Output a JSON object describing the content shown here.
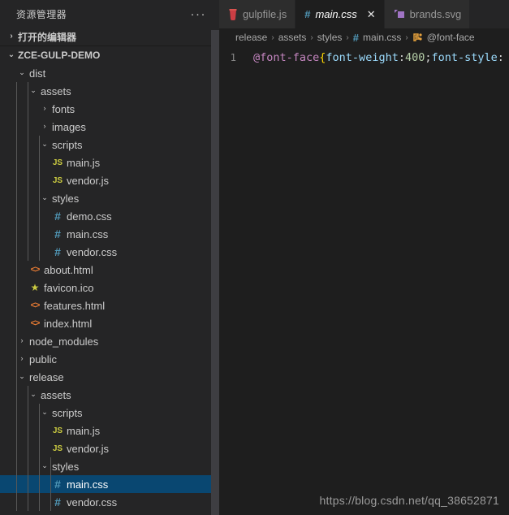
{
  "sidebar": {
    "title": "资源管理器",
    "more_actions_label": "···",
    "open_editors": {
      "label": "打开的编辑器",
      "chevron": "›",
      "expanded": false
    },
    "project": {
      "label": "ZCE-GULP-DEMO",
      "chevron": "⌄",
      "expanded": true
    },
    "tree": [
      {
        "label": "dist",
        "depth": 1,
        "type": "folder",
        "expanded": true,
        "chevron": "⌄"
      },
      {
        "label": "assets",
        "depth": 2,
        "type": "folder",
        "expanded": true,
        "chevron": "⌄"
      },
      {
        "label": "fonts",
        "depth": 3,
        "type": "folder",
        "expanded": false,
        "chevron": "›"
      },
      {
        "label": "images",
        "depth": 3,
        "type": "folder",
        "expanded": false,
        "chevron": "›"
      },
      {
        "label": "scripts",
        "depth": 3,
        "type": "folder",
        "expanded": true,
        "chevron": "⌄"
      },
      {
        "label": "main.js",
        "depth": 4,
        "type": "js",
        "icon": "js-icon"
      },
      {
        "label": "vendor.js",
        "depth": 4,
        "type": "js",
        "icon": "js-icon"
      },
      {
        "label": "styles",
        "depth": 3,
        "type": "folder",
        "expanded": true,
        "chevron": "⌄"
      },
      {
        "label": "demo.css",
        "depth": 4,
        "type": "css",
        "icon": "css-icon"
      },
      {
        "label": "main.css",
        "depth": 4,
        "type": "css",
        "icon": "css-icon"
      },
      {
        "label": "vendor.css",
        "depth": 4,
        "type": "css",
        "icon": "css-icon"
      },
      {
        "label": "about.html",
        "depth": 2,
        "type": "html",
        "icon": "html-icon"
      },
      {
        "label": "favicon.ico",
        "depth": 2,
        "type": "ico",
        "icon": "star-icon"
      },
      {
        "label": "features.html",
        "depth": 2,
        "type": "html",
        "icon": "html-icon"
      },
      {
        "label": "index.html",
        "depth": 2,
        "type": "html",
        "icon": "html-icon"
      },
      {
        "label": "node_modules",
        "depth": 1,
        "type": "folder",
        "expanded": false,
        "chevron": "›"
      },
      {
        "label": "public",
        "depth": 1,
        "type": "folder",
        "expanded": false,
        "chevron": "›"
      },
      {
        "label": "release",
        "depth": 1,
        "type": "folder",
        "expanded": true,
        "chevron": "⌄"
      },
      {
        "label": "assets",
        "depth": 2,
        "type": "folder",
        "expanded": true,
        "chevron": "⌄"
      },
      {
        "label": "scripts",
        "depth": 3,
        "type": "folder",
        "expanded": true,
        "chevron": "⌄"
      },
      {
        "label": "main.js",
        "depth": 4,
        "type": "js",
        "icon": "js-icon"
      },
      {
        "label": "vendor.js",
        "depth": 4,
        "type": "js",
        "icon": "js-icon"
      },
      {
        "label": "styles",
        "depth": 3,
        "type": "folder",
        "expanded": true,
        "chevron": "⌄"
      },
      {
        "label": "main.css",
        "depth": 4,
        "type": "css",
        "icon": "css-icon",
        "selected": true
      },
      {
        "label": "vendor.css",
        "depth": 4,
        "type": "css",
        "icon": "css-icon"
      }
    ]
  },
  "tabs": [
    {
      "label": "gulpfile.js",
      "icon": "gulp-icon",
      "active": false,
      "closable": false
    },
    {
      "label": "main.css",
      "icon": "css-icon",
      "active": true,
      "closable": true,
      "close_label": "✕",
      "preview": true
    },
    {
      "label": "brands.svg",
      "icon": "svg-icon",
      "active": false,
      "closable": false
    }
  ],
  "breadcrumb": {
    "separator": "›",
    "items": [
      "release",
      "assets",
      "styles",
      "main.css",
      "@font-face"
    ],
    "file_icon": "css-icon",
    "symbol_icon": "at-rule-icon"
  },
  "code": {
    "line_number": "1",
    "tokens": [
      {
        "t": "@font-face",
        "c": "c-at"
      },
      {
        "t": "{",
        "c": "c-brace"
      },
      {
        "t": "font-weight",
        "c": "c-prop"
      },
      {
        "t": ":",
        "c": "c-colon"
      },
      {
        "t": "400",
        "c": "c-num"
      },
      {
        "t": ";",
        "c": "c-semi"
      },
      {
        "t": "font-style",
        "c": "c-prop"
      },
      {
        "t": ":",
        "c": "c-colon"
      }
    ]
  },
  "watermark": "https://blog.csdn.net/qq_38652871",
  "colors": {
    "sidebar_bg": "#252526",
    "editor_bg": "#1e1e1e",
    "selection_blue": "#094771",
    "tab_inactive_bg": "#2d2d2d",
    "css_icon": "#519aba",
    "js_icon": "#cbcb41",
    "html_icon": "#e37933",
    "svg_icon": "#a074c4",
    "gulp_icon": "#cc3e44"
  }
}
